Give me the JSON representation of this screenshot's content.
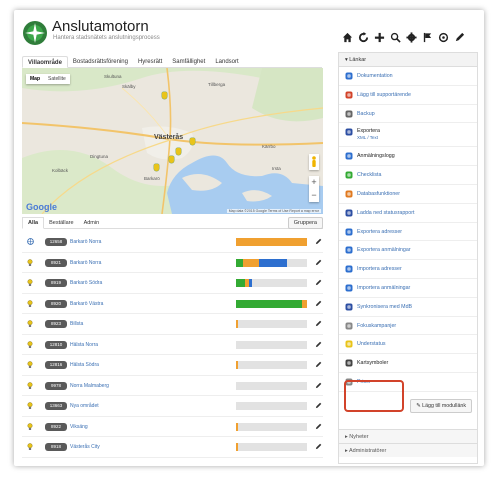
{
  "app": {
    "title": "Anslutamotorn",
    "subtitle": "Hantera stadsnätets anslutningsprocess"
  },
  "toolbar": [
    "home-icon",
    "refresh-icon",
    "plus-icon",
    "search-icon",
    "gear-icon",
    "flag-icon",
    "settings-icon",
    "pencil-icon"
  ],
  "tabs": [
    {
      "label": "Villaområde",
      "active": true
    },
    {
      "label": "Bostadsrättsförening",
      "active": false
    },
    {
      "label": "Hyresrätt",
      "active": false
    },
    {
      "label": "Samfällighet",
      "active": false
    },
    {
      "label": "Landsort",
      "active": false
    }
  ],
  "map": {
    "type_buttons": [
      "Map",
      "Satellite"
    ],
    "selected": "Map",
    "city": "Västerås",
    "places": [
      "Skultuna",
      "Skälby",
      "Tillberga",
      "Kolbäck",
      "Dingtuna",
      "Barkarö",
      "Irsta",
      "Kärrbo"
    ],
    "google": "Google",
    "footer": "Map data ©2015 Google   Terms of Use   Report a map error",
    "zoom_in": "+",
    "zoom_out": "−"
  },
  "subtabs": [
    "Alla",
    "Beställare",
    "Admin"
  ],
  "group_button": "Gruppera",
  "rows": [
    {
      "icon": "globe-icon",
      "badge": "12658",
      "name": "Barkarö Norra",
      "segments": [
        {
          "color": "#f0a030",
          "pct": 1.0
        }
      ]
    },
    {
      "icon": "bulb-icon",
      "badge": "8921",
      "name": "Barkarö Norra",
      "segments": [
        {
          "color": "#33aa33",
          "pct": 0.1
        },
        {
          "color": "#f0a030",
          "pct": 0.22
        },
        {
          "color": "#2d6fcf",
          "pct": 0.4
        }
      ]
    },
    {
      "icon": "bulb-icon",
      "badge": "8919",
      "name": "Barkarö Södra",
      "segments": [
        {
          "color": "#33aa33",
          "pct": 0.12
        },
        {
          "color": "#f0a030",
          "pct": 0.06
        },
        {
          "color": "#2d6fcf",
          "pct": 0.04
        }
      ]
    },
    {
      "icon": "bulb-icon",
      "badge": "8920",
      "name": "Barkarö Västra",
      "segments": [
        {
          "color": "#33aa33",
          "pct": 0.93
        },
        {
          "color": "#f0a030",
          "pct": 0.07
        }
      ]
    },
    {
      "icon": "bulb-icon",
      "badge": "8923",
      "name": "Billsta",
      "segments": [
        {
          "color": "#f0a030",
          "pct": 0.03
        }
      ]
    },
    {
      "icon": "bulb-icon",
      "badge": "12810",
      "name": "Hälsta Norra",
      "segments": []
    },
    {
      "icon": "bulb-icon",
      "badge": "12816",
      "name": "Hälsta Södra",
      "segments": [
        {
          "color": "#f0a030",
          "pct": 0.03
        }
      ]
    },
    {
      "icon": "bulb-icon",
      "badge": "9978",
      "name": "Norra Malmaberg",
      "segments": []
    },
    {
      "icon": "bulb-icon",
      "badge": "13663",
      "name": "Nya området",
      "segments": []
    },
    {
      "icon": "bulb-icon",
      "badge": "8922",
      "name": "Viksäng",
      "segments": [
        {
          "color": "#f0a030",
          "pct": 0.03
        }
      ]
    },
    {
      "icon": "bulb-icon",
      "badge": "8918",
      "name": "Västerås City",
      "segments": [
        {
          "color": "#f0a030",
          "pct": 0.03
        }
      ]
    }
  ],
  "sidebar": {
    "heading": "Länkar",
    "items": [
      {
        "icon": "document-icon",
        "color": "#2d6fcf",
        "label": "Dokumentation",
        "dark": false
      },
      {
        "icon": "support-icon",
        "color": "#d2432a",
        "label": "Lägg till supportärende",
        "dark": false
      },
      {
        "icon": "backup-icon",
        "color": "#666666",
        "label": "Backup",
        "dark": false
      },
      {
        "icon": "export-icon",
        "color": "#2d4fa3",
        "label": "Exportera",
        "sub": "XML / Text",
        "dark": true
      },
      {
        "icon": "log-icon",
        "color": "#2d6fcf",
        "label": "Anmälningslogg",
        "dark": true
      },
      {
        "icon": "checklist-icon",
        "color": "#33aa33",
        "label": "Checklista",
        "dark": false
      },
      {
        "icon": "database-icon",
        "color": "#e07a20",
        "label": "Databasfunktioner",
        "dark": false
      },
      {
        "icon": "upload-icon",
        "color": "#2d4fa3",
        "label": "Ladda ned statusrapport",
        "dark": false
      },
      {
        "icon": "export-icon",
        "color": "#2d6fcf",
        "label": "Exportera adresser",
        "dark": false
      },
      {
        "icon": "export-icon",
        "color": "#2d6fcf",
        "label": "Exportera anmälningar",
        "dark": false
      },
      {
        "icon": "import-icon",
        "color": "#2d6fcf",
        "label": "Importera adresser",
        "dark": false
      },
      {
        "icon": "import-icon",
        "color": "#2d6fcf",
        "label": "Importera anmälningar",
        "dark": false
      },
      {
        "icon": "sync-icon",
        "color": "#2d4fa3",
        "label": "Synkronisera med MdB",
        "dark": false
      },
      {
        "icon": "search-icon",
        "color": "#888888",
        "label": "Fokuskampanjer",
        "dark": false
      },
      {
        "icon": "star-icon",
        "color": "#e9c41a",
        "label": "Understatus",
        "dark": false
      },
      {
        "icon": "map-symbols-icon",
        "color": "#444444",
        "label": "Kartsymboler",
        "dark": true
      },
      {
        "icon": "price-icon",
        "color": "#888888",
        "label": "Priser",
        "dark": false
      }
    ],
    "add_link": "Lägg till modullänk",
    "footer": [
      "Nyheter",
      "Administratörer"
    ]
  }
}
